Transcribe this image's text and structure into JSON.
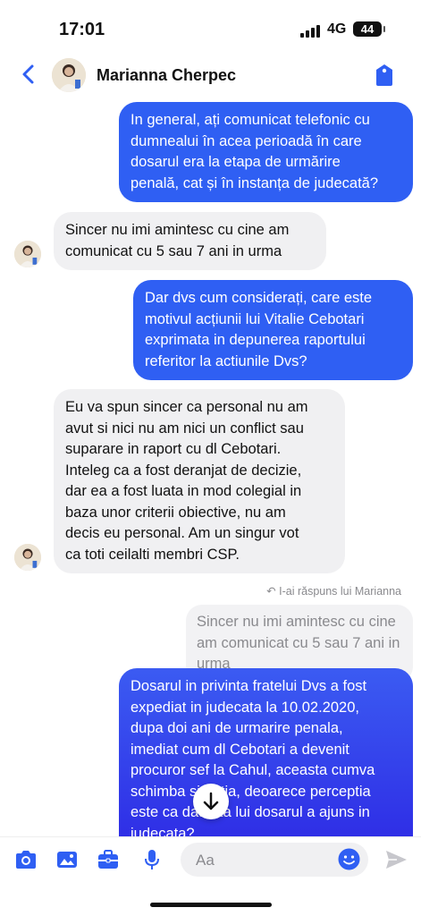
{
  "status_bar": {
    "time": "17:01",
    "network": "4G",
    "battery": "44"
  },
  "header": {
    "contact_name": "Marianna Cherpec"
  },
  "messages": [
    {
      "lines": [
        "In general, ați comunicat telefonic  cu",
        "dumnealui în acea perioadă în care",
        "dosarul era la etapa de urmărire",
        "penală, cat și în instanța de judecată?"
      ]
    },
    {
      "lines": [
        "Sincer nu imi amintesc cu cine am",
        "comunicat cu 5 sau 7 ani in urma"
      ]
    },
    {
      "lines": [
        "Dar dvs cum considerați, care este",
        "motivul acțiunii lui Vitalie Cebotari",
        "exprimata in depunerea raportului",
        "referitor la actiunile Dvs?"
      ]
    },
    {
      "lines": [
        "Eu va spun sincer ca personal nu am",
        "avut si nici nu am nici un conflict sau",
        "suparare in raport cu dl Cebotari.",
        "Inteleg ca a fost deranjat de decizie,",
        "dar ea a fost luata in mod colegial in",
        "baza unor criterii obiective, nu am",
        "decis eu personal. Am un singur vot",
        "ca toti ceilalti membri CSP."
      ]
    },
    {
      "lines": [
        "Dosarul in privinta fratelui Dvs a fost",
        "expediat in judecata la 10.02.2020,",
        "dupa doi ani de urmarire penala,",
        "imediat cum dl Cebotari a devenit",
        "procuror sef la Cahul, aceasta cumva",
        "schimba  situatia, deoarece perceptia",
        "este ca datorita lui dosarul a ajuns in",
        "judecata?"
      ]
    }
  ],
  "reply": {
    "meta": "I-ai răspuns lui Marianna",
    "quote_lines": [
      "Sincer nu imi amintesc cu cine",
      "am comunicat cu 5 sau 7 ani in",
      "urma"
    ]
  },
  "composer": {
    "placeholder": "Aa"
  },
  "icons": {
    "back": "chevron-left-icon",
    "header_action": "tag-icon",
    "composer": [
      "camera-icon",
      "gallery-icon",
      "briefcase-icon",
      "microphone-icon",
      "emoji-icon",
      "send-icon"
    ],
    "scroll": "arrow-down-icon"
  },
  "colors": {
    "accent": "#2f5ff3",
    "outgoing_bubble": "#2f5ff3",
    "incoming_bubble": "#f0f0f2"
  }
}
